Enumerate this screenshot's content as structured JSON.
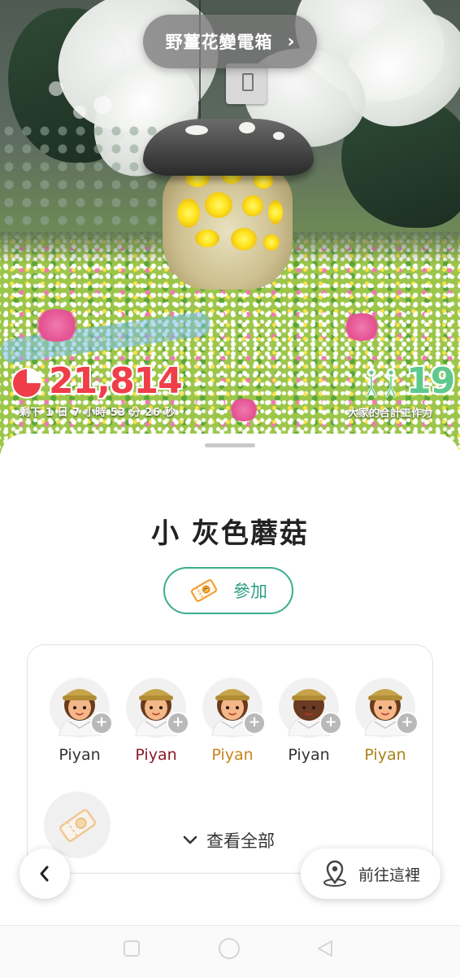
{
  "location": {
    "name": "野薑花變電箱",
    "chevron": "›"
  },
  "stats": {
    "hp_value": "21,814",
    "time_left": "剩下 1 日 7 小時 53 分 26 秒",
    "work_value": "19",
    "work_label": "大家的合計工作力",
    "time_fraction_remaining": 0.75
  },
  "target": {
    "title": "小 灰色蘑菇",
    "join_label": "參加"
  },
  "members": [
    {
      "name": "Piyan",
      "color": "#333333",
      "skin": "#f3b78a"
    },
    {
      "name": "Piyan",
      "color": "#8a1c2a",
      "skin": "#f3b78a"
    },
    {
      "name": "Piyan",
      "color": "#c8841a",
      "skin": "#f3b78a"
    },
    {
      "name": "Piyan",
      "color": "#333333",
      "skin": "#6b3b26"
    },
    {
      "name": "Piyan",
      "color": "#a8821a",
      "skin": "#f3b78a"
    }
  ],
  "view_all_label": "查看全部",
  "go_label": "前往這裡",
  "accent_color": "#3aad8f",
  "hp_color": "#ef3e4a",
  "work_color": "#5fc98d"
}
